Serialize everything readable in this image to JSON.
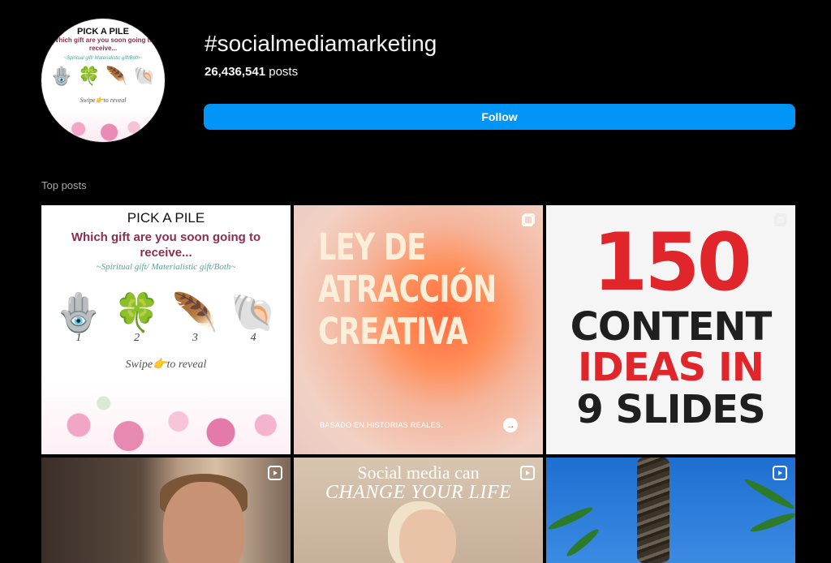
{
  "hashtag": {
    "title": "#socialmediamarketing",
    "post_count": "26,436,541",
    "post_count_suffix": "posts",
    "follow_label": "Follow"
  },
  "avatar": {
    "title": "PICK A PILE",
    "question": "Which gift are you soon going to receive...",
    "options": "~Spiritual gift/ Materialistic gift/Both~",
    "swipe": "Swipe👉to reveal"
  },
  "section_label": "Top posts",
  "posts": [
    {
      "type": "image",
      "title": "PICK A PILE",
      "question": "Which gift are you soon going to receive...",
      "options": "~Spiritual gift/ Materialistic gift/Both~",
      "numbers": [
        "1",
        "2",
        "3",
        "4"
      ],
      "swipe": "Swipe👉to reveal"
    },
    {
      "type": "carousel",
      "headline_lines": [
        "LEY DE",
        "ATRACCIÓN",
        "CREATIVA"
      ],
      "footer": "BASADO EN HISTORIAS REALES."
    },
    {
      "type": "carousel",
      "number": "150",
      "line1": "CONTENT",
      "line2": "IDEAS IN",
      "line3": "9 SLIDES"
    },
    {
      "type": "reel"
    },
    {
      "type": "reel",
      "line1": "Social media can",
      "line2": "CHANGE YOUR LIFE"
    },
    {
      "type": "reel"
    }
  ]
}
